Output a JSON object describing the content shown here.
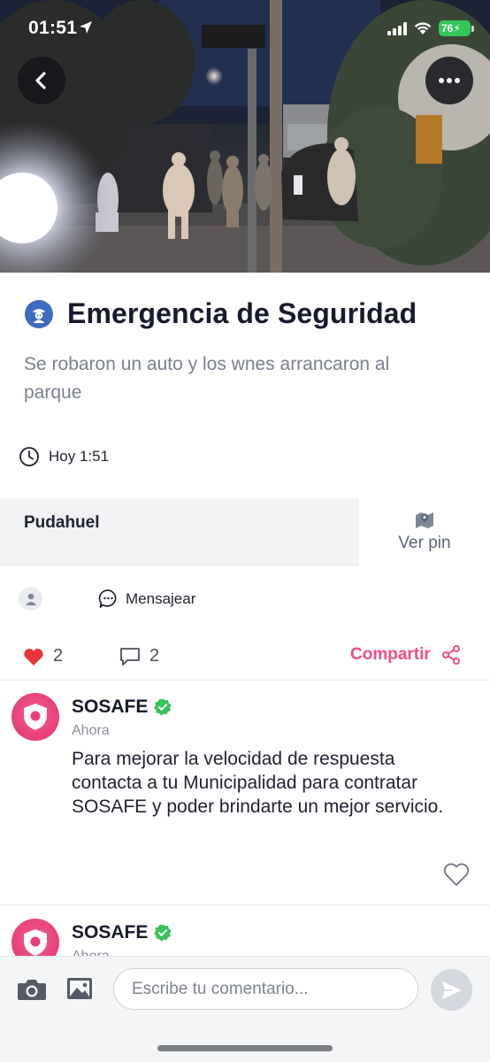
{
  "status_bar": {
    "time": "01:51",
    "battery": "76",
    "icons": [
      "location-arrow-icon",
      "signal-icon",
      "wifi-icon",
      "battery-icon"
    ]
  },
  "hero": {
    "back_icon": "chevron-left-icon",
    "more_icon": "ellipsis-icon"
  },
  "post": {
    "category_icon": "security-guard-icon",
    "title": "Emergencia de Seguridad",
    "description": "Se robaron un auto y los wnes arrancaron al parque",
    "time_icon": "clock-icon",
    "time": "Hoy 1:51"
  },
  "location": {
    "name": "Pudahuel",
    "pin_label": "Ver pin",
    "pin_icon": "map-pin-icon"
  },
  "author_row": {
    "avatar_icon": "user-icon",
    "message_label": "Mensajear",
    "message_icon": "chat-bubble-icon"
  },
  "actions": {
    "likes": "2",
    "comments": "2",
    "share_label": "Compartir",
    "like_color": "#e8343d",
    "accent_color": "#ef4d8a"
  },
  "comments": [
    {
      "author": "SOSAFE",
      "verified": true,
      "time": "Ahora",
      "text": "Para mejorar la velocidad de respuesta contacta a tu Municipalidad para contratar SOSAFE y poder brindarte un mejor servicio."
    },
    {
      "author": "SOSAFE",
      "verified": true,
      "time": "Ahora"
    }
  ],
  "composer": {
    "placeholder": "Escribe tu comentario...",
    "camera_icon": "camera-icon",
    "gallery_icon": "image-icon",
    "send_icon": "send-icon"
  }
}
